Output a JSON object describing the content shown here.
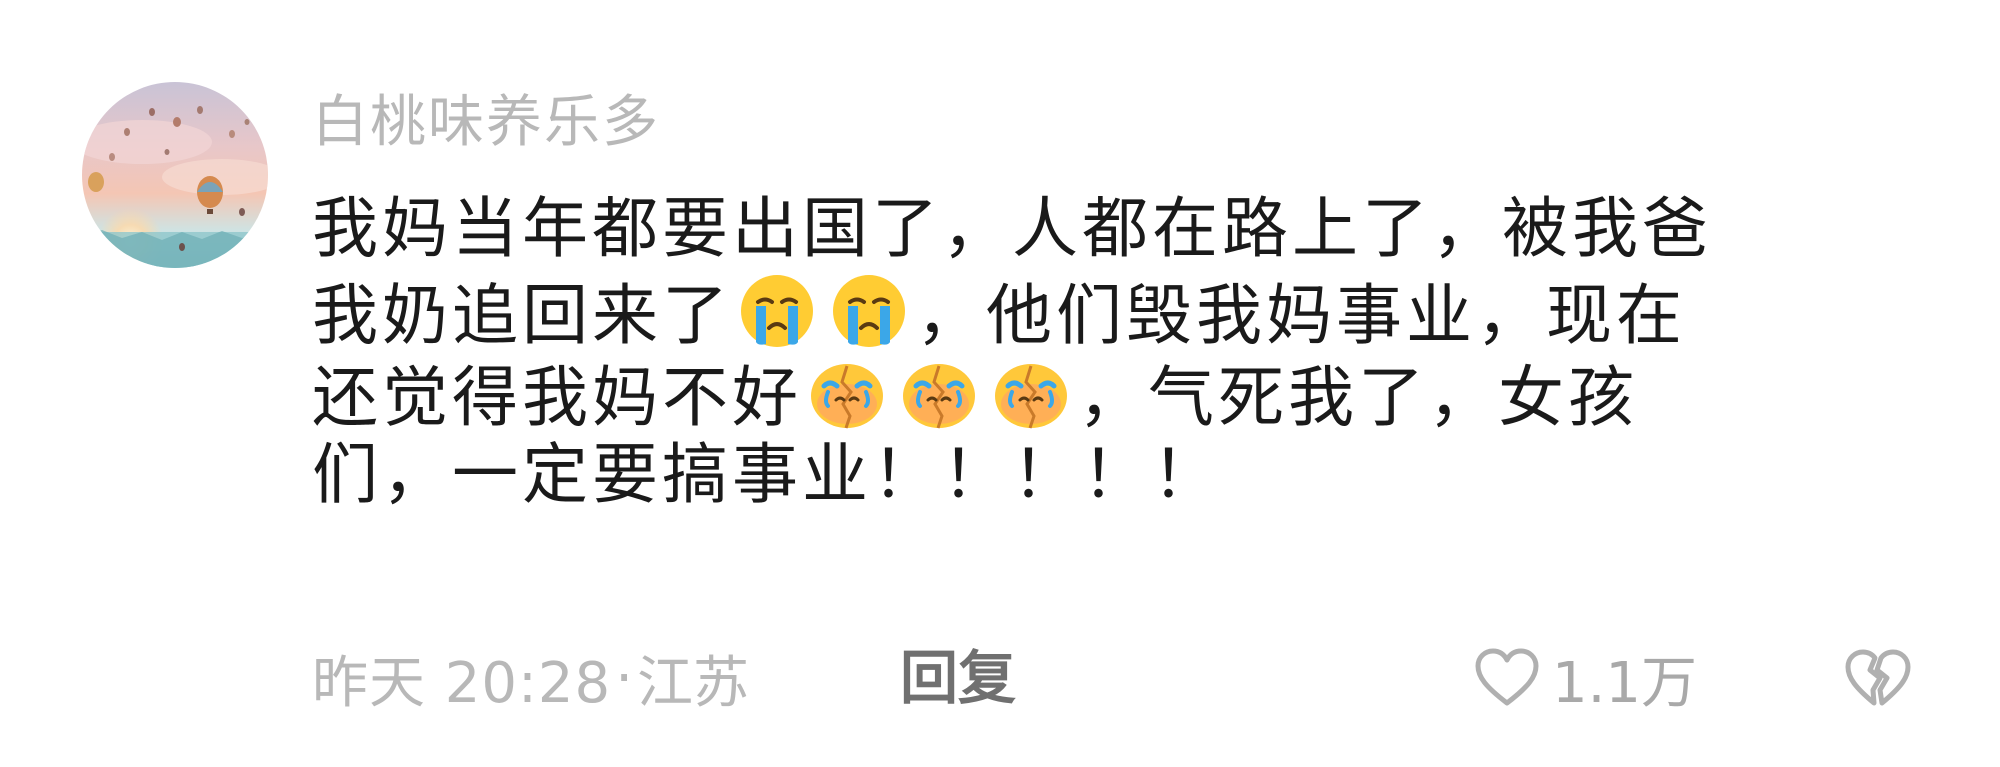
{
  "comment": {
    "username": "白桃味养乐多",
    "avatar_icon": "hot-air-balloon-sunset-avatar",
    "lines": [
      "我妈当年都要出国了，人都在路上了，被我爸",
      [
        "我奶追回来了",
        "crying-face-icon",
        "crying-face-icon",
        "，他们毁我妈事业，现在"
      ],
      [
        "还觉得我妈不好",
        "broken-heart-crying-face-icon",
        "broken-heart-crying-face-icon",
        "broken-heart-crying-face-icon",
        "，气死我了，女孩"
      ],
      "们，一定要搞事业！！！！！"
    ],
    "line_1": "我妈当年都要出国了，人都在路上了，被我爸",
    "line_2a": "我奶追回来了",
    "line_2b": "，他们毁我妈事业，现在",
    "line_3a": "还觉得我妈不好",
    "line_3b": "，气死我了，女孩",
    "line_4": "们，一定要搞事业！！！！！"
  },
  "meta": {
    "time": "昨天 20:28",
    "separator": "·",
    "location": "江苏",
    "reply_label": "回复"
  },
  "actions": {
    "like_icon": "heart-outline-icon",
    "like_count": "1.1万",
    "dislike_icon": "broken-heart-outline-icon"
  },
  "colors": {
    "username": "#b8b8b8",
    "body_text": "#1a1a1a",
    "meta_text": "#b8b8b8",
    "reply_text": "#707070"
  }
}
